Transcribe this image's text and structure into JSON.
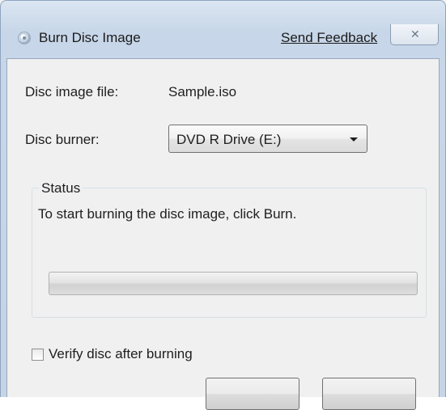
{
  "window": {
    "title": "Burn Disc Image",
    "feedback_link": "Send Feedback",
    "close_glyph": "✕"
  },
  "form": {
    "image_file_label": "Disc image file:",
    "image_file_value": "Sample.iso",
    "burner_label": "Disc burner:",
    "burner_selected": "DVD R Drive (E:)"
  },
  "status": {
    "group_title": "Status",
    "message": "To start burning the disc image, click Burn.",
    "progress": 0
  },
  "options": {
    "verify_label": "Verify disc after burning",
    "verify_checked": false
  },
  "icons": {
    "app": "disc-icon",
    "close": "close-icon",
    "dropdown": "chevron-down-icon"
  },
  "colors": {
    "frame": "#c6d5e6",
    "client_bg": "#f0f0f0"
  }
}
